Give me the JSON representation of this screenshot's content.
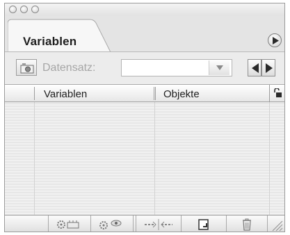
{
  "window": {
    "controls": [
      "close-button",
      "minimize-button",
      "zoom-button"
    ]
  },
  "panel": {
    "tab_label": "Variablen",
    "menu_icon": "triangle-right-icon"
  },
  "toolbar": {
    "snapshot_icon": "camera-icon",
    "dataset_label": "Datensatz:",
    "dataset_value": "",
    "dropdown_icon": "chevron-down-icon",
    "prev_icon": "triangle-left-icon",
    "next_icon": "triangle-right-icon"
  },
  "table": {
    "columns": [
      "Variablen",
      "Objekte"
    ],
    "lock_icon": "lock-icon",
    "rows": []
  },
  "bottom_toolbar": {
    "buttons": [
      {
        "name": "bind-visibility-button",
        "icon": "gear-link-icon"
      },
      {
        "name": "bind-visibility-eye-button",
        "icon": "gear-eye-icon"
      },
      {
        "name": "unbind-button",
        "icon": "unlink-icon"
      },
      {
        "name": "new-variable-button",
        "icon": "new-page-icon"
      },
      {
        "name": "delete-variable-button",
        "icon": "trash-icon"
      }
    ],
    "resize_icon": "resize-grip-icon"
  }
}
